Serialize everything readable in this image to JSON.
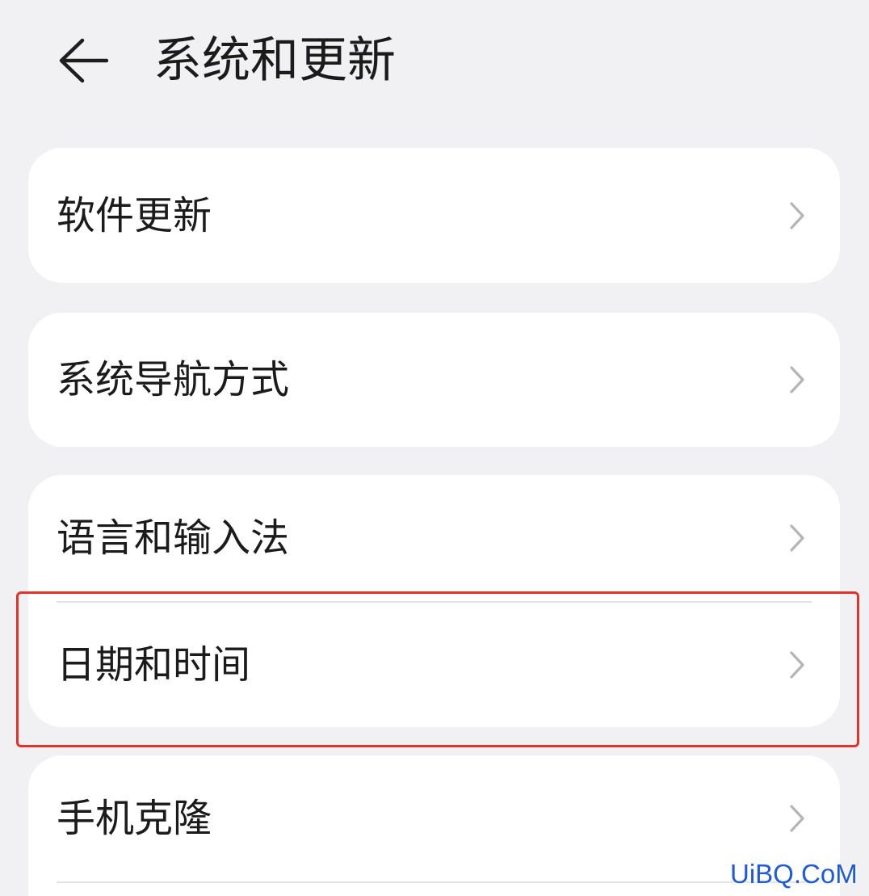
{
  "header": {
    "back_icon": "arrow-left-icon",
    "title": "系统和更新"
  },
  "groups": [
    {
      "items": [
        {
          "label": "软件更新",
          "icon": "chevron-right-icon"
        }
      ]
    },
    {
      "items": [
        {
          "label": "系统导航方式",
          "icon": "chevron-right-icon"
        }
      ]
    },
    {
      "items": [
        {
          "label": "语言和输入法",
          "icon": "chevron-right-icon"
        },
        {
          "label": "日期和时间",
          "icon": "chevron-right-icon",
          "highlighted": true
        }
      ]
    },
    {
      "items": [
        {
          "label": "手机克隆",
          "icon": "chevron-right-icon"
        }
      ]
    }
  ],
  "watermark": {
    "text": "UiBQ.CoM"
  },
  "colors": {
    "background": "#f1f1f3",
    "card": "#ffffff",
    "text": "#1b1b1b",
    "chevron": "#b5b5b5",
    "divider": "#e2e2e2",
    "highlight": "#e6302b",
    "watermark": "#1f5ad8"
  }
}
